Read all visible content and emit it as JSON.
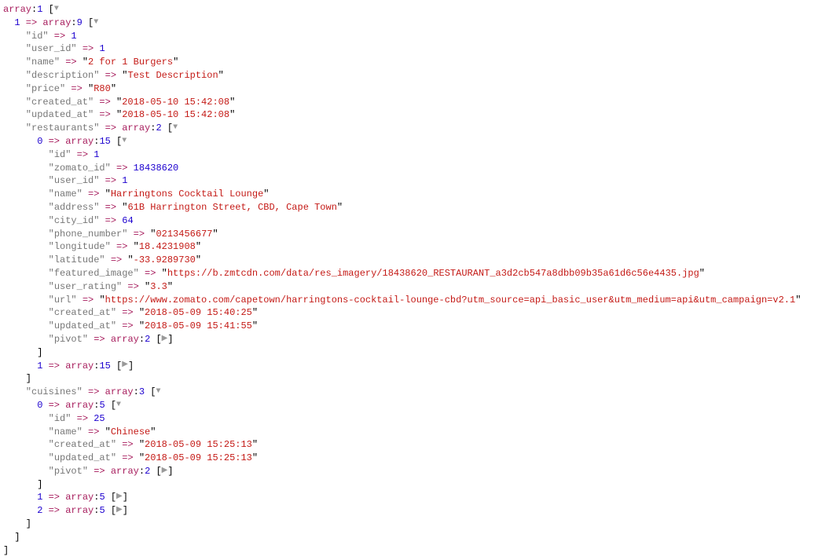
{
  "root": {
    "type_label": "array",
    "count": "1",
    "items": [
      {
        "index": "1",
        "type_label": "array",
        "count": "9",
        "fields": {
          "id": {
            "k": "id",
            "v": "1",
            "kind": "num"
          },
          "user_id": {
            "k": "user_id",
            "v": "1",
            "kind": "num"
          },
          "name": {
            "k": "name",
            "v": "2 for 1 Burgers",
            "kind": "str"
          },
          "description": {
            "k": "description",
            "v": "Test Description",
            "kind": "str"
          },
          "price": {
            "k": "price",
            "v": "R80",
            "kind": "str"
          },
          "created_at": {
            "k": "created_at",
            "v": "2018-05-10 15:42:08",
            "kind": "str"
          },
          "updated_at": {
            "k": "updated_at",
            "v": "2018-05-10 15:42:08",
            "kind": "str"
          }
        },
        "restaurants": {
          "k": "restaurants",
          "type_label": "array",
          "count": "2",
          "items": [
            {
              "index": "0",
              "type_label": "array",
              "count": "15",
              "fields": {
                "id": {
                  "k": "id",
                  "v": "1",
                  "kind": "num"
                },
                "zomato_id": {
                  "k": "zomato_id",
                  "v": "18438620",
                  "kind": "num"
                },
                "user_id": {
                  "k": "user_id",
                  "v": "1",
                  "kind": "num"
                },
                "name": {
                  "k": "name",
                  "v": "Harringtons Cocktail Lounge",
                  "kind": "str"
                },
                "address": {
                  "k": "address",
                  "v": "61B Harrington Street, CBD, Cape Town",
                  "kind": "str"
                },
                "city_id": {
                  "k": "city_id",
                  "v": "64",
                  "kind": "num"
                },
                "phone_number": {
                  "k": "phone_number",
                  "v": "0213456677",
                  "kind": "str"
                },
                "longitude": {
                  "k": "longitude",
                  "v": "18.4231908",
                  "kind": "str"
                },
                "latitude": {
                  "k": "latitude",
                  "v": "-33.9289730",
                  "kind": "str"
                },
                "featured_image": {
                  "k": "featured_image",
                  "v": "https://b.zmtcdn.com/data/res_imagery/18438620_RESTAURANT_a3d2cb547a8dbb09b35a61d6c56e4435.jpg",
                  "kind": "str"
                },
                "user_rating": {
                  "k": "user_rating",
                  "v": "3.3",
                  "kind": "str"
                },
                "url": {
                  "k": "url",
                  "v": "https://www.zomato.com/capetown/harringtons-cocktail-lounge-cbd?utm_source=api_basic_user&utm_medium=api&utm_campaign=v2.1",
                  "kind": "str"
                },
                "created_at": {
                  "k": "created_at",
                  "v": "2018-05-09 15:40:25",
                  "kind": "str"
                },
                "updated_at": {
                  "k": "updated_at",
                  "v": "2018-05-09 15:41:55",
                  "kind": "str"
                }
              },
              "pivot": {
                "k": "pivot",
                "type_label": "array",
                "count": "2"
              }
            },
            {
              "index": "1",
              "type_label": "array",
              "count": "15"
            }
          ]
        },
        "cuisines": {
          "k": "cuisines",
          "type_label": "array",
          "count": "3",
          "items": [
            {
              "index": "0",
              "type_label": "array",
              "count": "5",
              "fields": {
                "id": {
                  "k": "id",
                  "v": "25",
                  "kind": "num"
                },
                "name": {
                  "k": "name",
                  "v": "Chinese",
                  "kind": "str"
                },
                "created_at": {
                  "k": "created_at",
                  "v": "2018-05-09 15:25:13",
                  "kind": "str"
                },
                "updated_at": {
                  "k": "updated_at",
                  "v": "2018-05-09 15:25:13",
                  "kind": "str"
                }
              },
              "pivot": {
                "k": "pivot",
                "type_label": "array",
                "count": "2"
              }
            },
            {
              "index": "1",
              "type_label": "array",
              "count": "5"
            },
            {
              "index": "2",
              "type_label": "array",
              "count": "5"
            }
          ]
        }
      }
    ]
  }
}
